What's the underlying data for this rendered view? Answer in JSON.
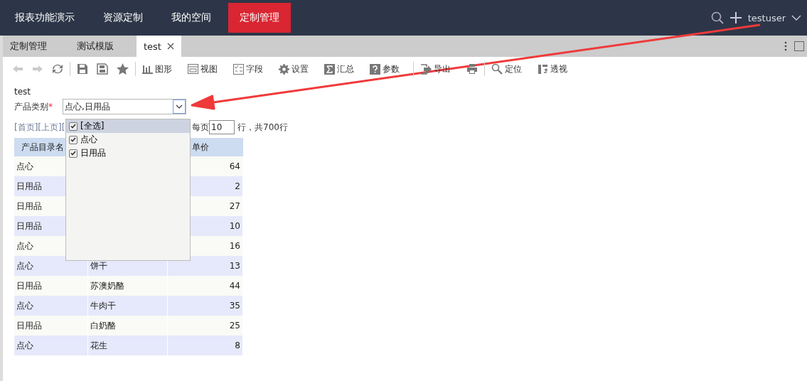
{
  "nav": {
    "items": [
      {
        "label": "报表功能演示",
        "selected": false
      },
      {
        "label": "资源定制",
        "selected": false
      },
      {
        "label": "我的空间",
        "selected": false
      },
      {
        "label": "定制管理",
        "selected": true
      }
    ],
    "user": "testuser"
  },
  "tabs": [
    {
      "label": "定制管理",
      "selected": false,
      "closable": false
    },
    {
      "label": "测试模版",
      "selected": false,
      "closable": false
    },
    {
      "label": "test",
      "selected": true,
      "closable": true
    }
  ],
  "toolbar": [
    {
      "kind": "icon",
      "disabled": true
    },
    {
      "kind": "icon",
      "disabled": true
    },
    {
      "kind": "icon",
      "disabled": false
    },
    {
      "kind": "separator"
    },
    {
      "kind": "icon",
      "disabled": false
    },
    {
      "kind": "icon",
      "disabled": false
    },
    {
      "kind": "icon",
      "disabled": false
    },
    {
      "kind": "separator"
    },
    {
      "kind": "labeled",
      "label": "图形",
      "disabled": false
    },
    {
      "kind": "labeled",
      "label": "视图",
      "disabled": false
    },
    {
      "kind": "labeled",
      "label": "字段",
      "disabled": false
    },
    {
      "kind": "labeled",
      "label": "设置",
      "disabled": false
    },
    {
      "kind": "labeled",
      "label": "汇总",
      "disabled": false
    },
    {
      "kind": "labeled",
      "label": "参数",
      "disabled": false
    },
    {
      "kind": "separator"
    },
    {
      "kind": "labeled",
      "label": "导出",
      "disabled": false
    },
    {
      "kind": "icon",
      "disabled": false
    },
    {
      "kind": "separator"
    },
    {
      "kind": "labeled",
      "label": "定位",
      "disabled": false
    },
    {
      "kind": "labeled",
      "label": "透视",
      "disabled": false
    }
  ],
  "report": {
    "title": "test",
    "filter": {
      "label": "产品类别",
      "required_mark": "*",
      "value": "点心,日用品",
      "options": [
        {
          "label": "[全选]",
          "checked": true,
          "selected": true
        },
        {
          "label": "点心",
          "checked": true,
          "selected": false
        },
        {
          "label": "日用品",
          "checked": true,
          "selected": false
        }
      ]
    },
    "pagination": {
      "links": "[首页][上页][",
      "per_page_label": "每页",
      "per_page_value": "10",
      "total": "行，共700行"
    },
    "table": {
      "columns": [
        "产品目录名",
        null,
        "单价"
      ],
      "rows": [
        [
          "点心",
          null,
          "64"
        ],
        [
          "日用品",
          null,
          "2"
        ],
        [
          "日用品",
          null,
          "27"
        ],
        [
          "日用品",
          null,
          "10"
        ],
        [
          "点心",
          null,
          "16"
        ],
        [
          "点心",
          "饼干",
          "13"
        ],
        [
          "日用品",
          "苏澳奶酪",
          "44"
        ],
        [
          "点心",
          "牛肉干",
          "35"
        ],
        [
          "日用品",
          "白奶酪",
          "25"
        ],
        [
          "点心",
          "花生",
          "8"
        ]
      ]
    }
  }
}
